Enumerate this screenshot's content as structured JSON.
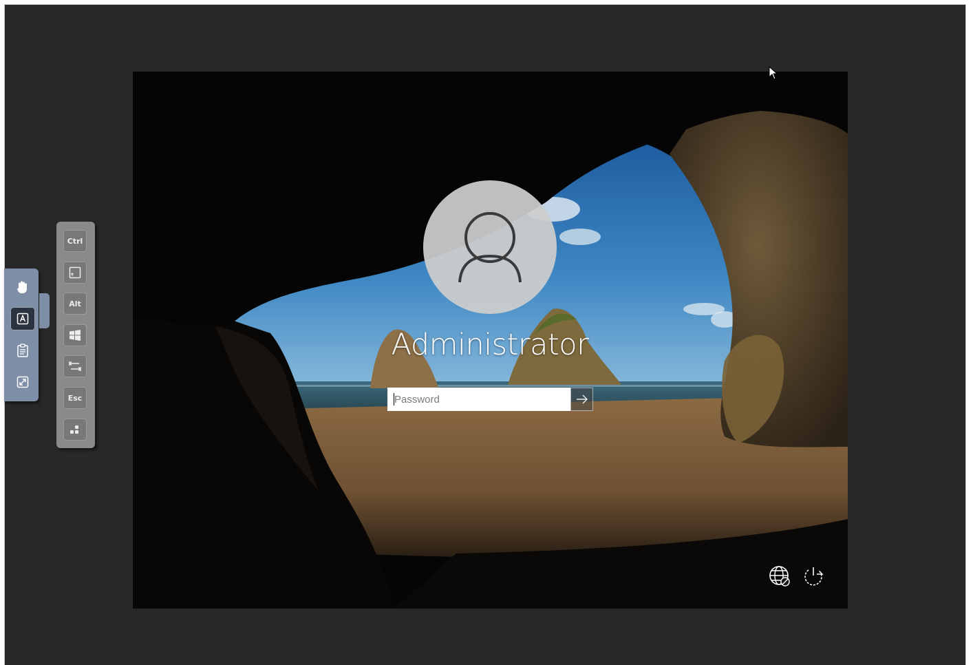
{
  "login": {
    "username": "Administrator",
    "password_placeholder": "Password",
    "password_value": "",
    "submit_icon": "arrow-right-icon"
  },
  "bottom_controls": {
    "network_icon": "network-disconnected-icon",
    "ease_of_access_icon": "ease-of-access-icon",
    "power_icon": "power-icon"
  },
  "side_toolbar": {
    "items": [
      {
        "icon": "hand-pan-icon",
        "active": false
      },
      {
        "icon": "keyboard-icon",
        "active": true
      },
      {
        "icon": "clipboard-icon",
        "active": false
      },
      {
        "icon": "fullscreen-icon",
        "active": false
      }
    ]
  },
  "key_toolbar": {
    "keys": [
      {
        "label": "Ctrl",
        "icon": ""
      },
      {
        "label": "",
        "icon": "shift-key-icon"
      },
      {
        "label": "Alt",
        "icon": ""
      },
      {
        "label": "",
        "icon": "windows-key-icon"
      },
      {
        "label": "",
        "icon": "tab-key-icon"
      },
      {
        "label": "Esc",
        "icon": ""
      },
      {
        "label": "",
        "icon": "more-keys-icon"
      }
    ]
  },
  "colors": {
    "viewer_background": "#282828",
    "toolbar_blue": "#7f8ea7",
    "toolbar_gray": "#8a8a8a"
  }
}
